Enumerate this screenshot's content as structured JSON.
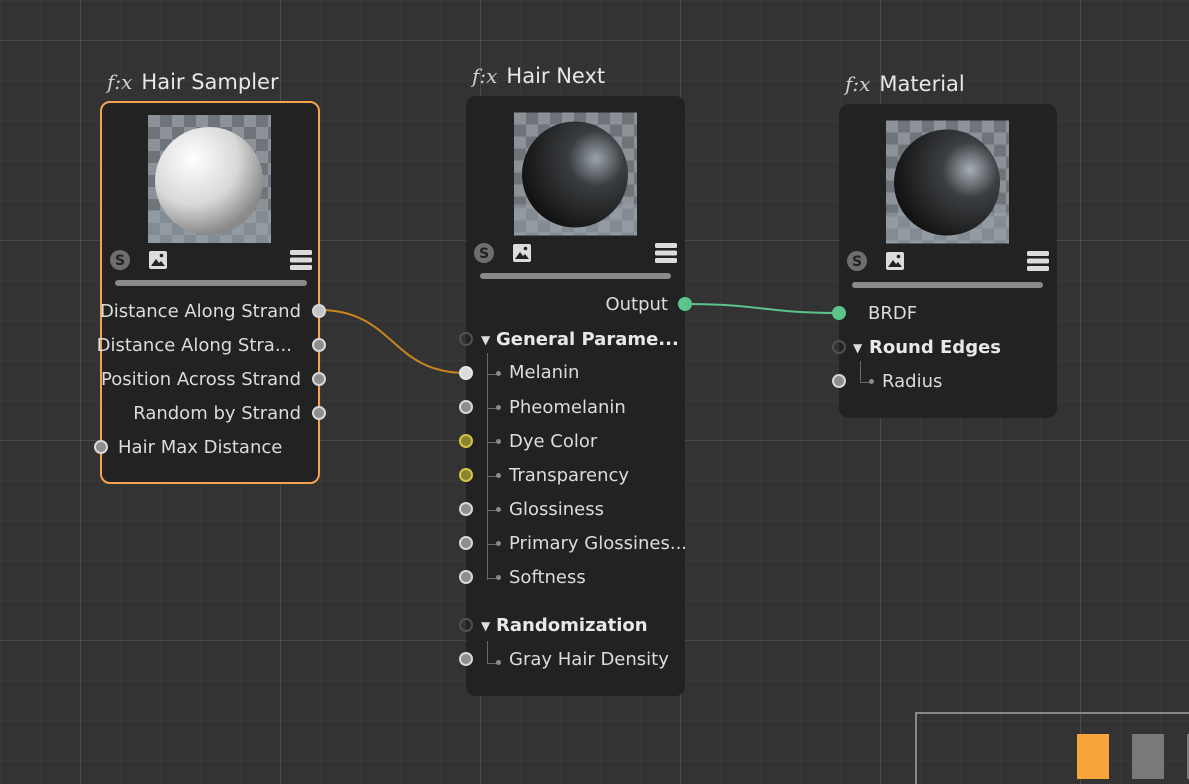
{
  "nodes": {
    "hair_sampler": {
      "fx": "f:x",
      "title": "Hair Sampler",
      "outputs": [
        "Distance Along Strand",
        "Distance Along Stra...",
        "Position Across Strand",
        "Random by Strand"
      ],
      "inputs": [
        "Hair Max Distance"
      ]
    },
    "hair_next": {
      "fx": "f:x",
      "title": "Hair Next",
      "output": "Output",
      "group1": "General Parame...",
      "params1": [
        "Melanin",
        "Pheomelanin",
        "Dye Color",
        "Transparency",
        "Glossiness",
        "Primary Glossines...",
        "Softness"
      ],
      "group2": "Randomization",
      "params2": [
        "Gray Hair Density"
      ]
    },
    "material": {
      "fx": "f:x",
      "title": "Material",
      "input": "BRDF",
      "group": "Round Edges",
      "params": [
        "Radius"
      ]
    }
  },
  "colors": {
    "selected_border": "#f4a54b",
    "wire_sampler": "#c9861d",
    "wire_output": "#5cc48a",
    "port_yellow": "#d4c44a",
    "minimap_orange": "#f7a43a"
  },
  "icons": [
    "shader-s-icon",
    "image-icon",
    "menu-icon",
    "collapse-triangle-icon"
  ]
}
